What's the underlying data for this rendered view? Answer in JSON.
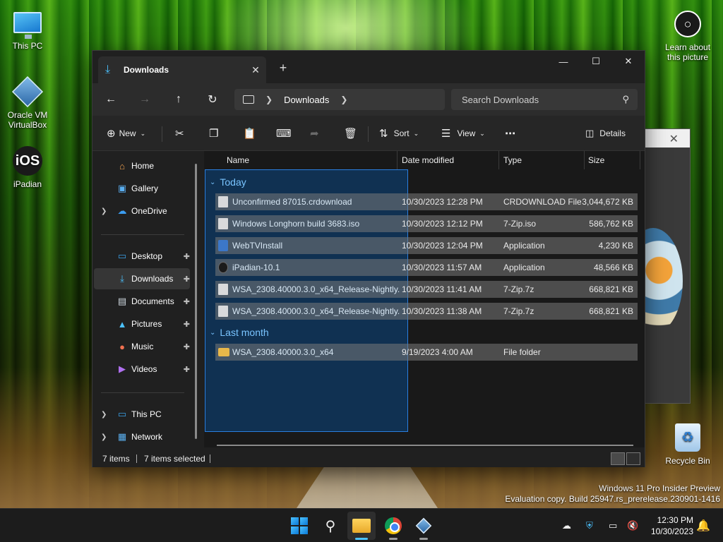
{
  "desktop": {
    "icons": [
      {
        "label": "This PC"
      },
      {
        "label": "Oracle VM VirtualBox"
      },
      {
        "label": "iPadian",
        "glyph": "iOS"
      },
      {
        "label": "Learn about this picture"
      },
      {
        "label": "Recycle Bin"
      }
    ],
    "watermark": {
      "line1": "Windows 11 Pro Insider Preview",
      "line2": "Evaluation copy. Build 25947.rs_prerelease.230901-1416"
    }
  },
  "explorer": {
    "tab": {
      "title": "Downloads"
    },
    "address": {
      "crumb": "Downloads"
    },
    "search": {
      "placeholder": "Search Downloads"
    },
    "toolbar": {
      "new_label": "New",
      "sort_label": "Sort",
      "view_label": "View",
      "details_label": "Details"
    },
    "sidebar": {
      "items": [
        {
          "label": "Home"
        },
        {
          "label": "Gallery"
        },
        {
          "label": "OneDrive"
        },
        {
          "label": "Desktop"
        },
        {
          "label": "Downloads"
        },
        {
          "label": "Documents"
        },
        {
          "label": "Pictures"
        },
        {
          "label": "Music"
        },
        {
          "label": "Videos"
        },
        {
          "label": "This PC"
        },
        {
          "label": "Network"
        }
      ]
    },
    "columns": {
      "name": "Name",
      "date": "Date modified",
      "type": "Type",
      "size": "Size"
    },
    "groups": {
      "today": "Today",
      "last_month": "Last month"
    },
    "files": [
      {
        "name": "Unconfirmed 87015.crdownload",
        "date": "10/30/2023 12:28 PM",
        "type": "CRDOWNLOAD File",
        "size": "3,044,672 KB"
      },
      {
        "name": "Windows Longhorn build 3683.iso",
        "date": "10/30/2023 12:12 PM",
        "type": "7-Zip.iso",
        "size": "586,762 KB"
      },
      {
        "name": "WebTVInstall",
        "date": "10/30/2023 12:04 PM",
        "type": "Application",
        "size": "4,230 KB"
      },
      {
        "name": "iPadian-10.1",
        "date": "10/30/2023 11:57 AM",
        "type": "Application",
        "size": "48,566 KB"
      },
      {
        "name": "WSA_2308.40000.3.0_x64_Release-Nightly...",
        "date": "10/30/2023 11:41 AM",
        "type": "7-Zip.7z",
        "size": "668,821 KB"
      },
      {
        "name": "WSA_2308.40000.3.0_x64_Release-Nightly...",
        "date": "10/30/2023 11:38 AM",
        "type": "7-Zip.7z",
        "size": "668,821 KB"
      },
      {
        "name": "WSA_2308.40000.3.0_x64",
        "date": "9/19/2023 4:00 AM",
        "type": "File folder",
        "size": ""
      }
    ],
    "status": {
      "count": "7 items",
      "selected": "7 items selected"
    }
  },
  "taskbar": {
    "clock": {
      "time": "12:30 PM",
      "date": "10/30/2023"
    }
  }
}
